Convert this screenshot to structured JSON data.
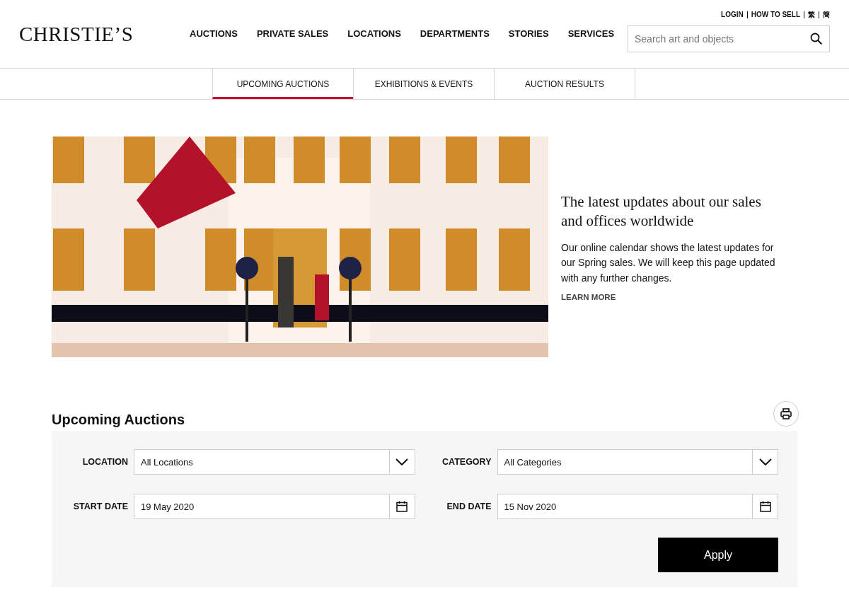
{
  "logo": "CHRISTIE’S",
  "utility_links": [
    "LOGIN",
    "HOW TO SELL",
    "繁",
    "簡"
  ],
  "nav": [
    "AUCTIONS",
    "PRIVATE SALES",
    "LOCATIONS",
    "DEPARTMENTS",
    "STORIES",
    "SERVICES"
  ],
  "search": {
    "placeholder": "Search art and objects"
  },
  "tabs": [
    {
      "label": "UPCOMING AUCTIONS",
      "selected": true
    },
    {
      "label": "EXHIBITIONS & EVENTS",
      "selected": false
    },
    {
      "label": "AUCTION RESULTS",
      "selected": false
    }
  ],
  "hero": {
    "title": "The latest updates about our sales and offices worldwide",
    "body": "Our online calendar shows the latest updates for our Spring sales. We will keep this page updated with any further changes.",
    "link": "LEARN MORE"
  },
  "section_title": "Upcoming Auctions",
  "filters": [
    {
      "label": "LOCATION",
      "kind": "select",
      "value": "All Locations"
    },
    {
      "label": "CATEGORY",
      "kind": "select",
      "value": "All Categories"
    },
    {
      "label": "START DATE",
      "kind": "date",
      "value": "19 May 2020"
    },
    {
      "label": "END DATE",
      "kind": "date",
      "value": "15 Nov 2020"
    }
  ],
  "apply_button": "Apply"
}
